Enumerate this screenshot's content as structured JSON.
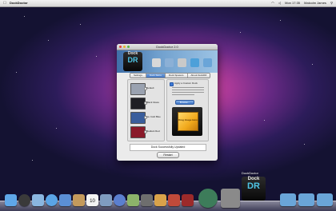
{
  "menubar": {
    "app": "DockDoctor",
    "clock": "Mon 17:35",
    "user": "Malcolm James"
  },
  "window": {
    "title": "DockDoctor 2.0",
    "logo_top": "Dock",
    "logo_main": "DR",
    "tabs": [
      {
        "label": "Settings",
        "active": false
      },
      {
        "label": "Dock Skins",
        "active": true
      },
      {
        "label": "Dock Spacers",
        "active": false
      },
      {
        "label": "About DockDR",
        "active": false
      }
    ],
    "themes": [
      {
        "label": "Default",
        "color": "#9aa2b0"
      },
      {
        "label": "Black Glass",
        "color": "#1f1f24"
      },
      {
        "label": "Ice Cold Blue",
        "color": "#3a5e9c"
      },
      {
        "label": "Radiant Red",
        "color": "#8a1a2a"
      }
    ],
    "custom_check_label": "Apply a Custom Dock",
    "browse_label": "Browse...",
    "preview_box_text": "Drag Image Here",
    "status": "Dock Successfully Updated",
    "restart_label": "Restart"
  },
  "dock": {
    "label": "DockDoctor",
    "logo_top": "Dock",
    "logo_main": "DR",
    "calendar_day": "10",
    "icons": [
      {
        "name": "finder-icon",
        "color": "#5fa7e8"
      },
      {
        "name": "dashboard-icon",
        "color": "#3a3a3a"
      },
      {
        "name": "mail-icon",
        "color": "#8ab6e0"
      },
      {
        "name": "safari-icon",
        "color": "#5aa4e6"
      },
      {
        "name": "ichat-icon",
        "color": "#5b8fd6"
      },
      {
        "name": "address-book-icon",
        "color": "#c49a5c"
      },
      {
        "name": "calendar-icon",
        "color": "#f4f4f4"
      },
      {
        "name": "preview-icon",
        "color": "#7f9cc0"
      },
      {
        "name": "itunes-icon",
        "color": "#5b7fcf"
      },
      {
        "name": "iphoto-icon",
        "color": "#8cb36a"
      },
      {
        "name": "imovie-icon",
        "color": "#6e6e6e"
      },
      {
        "name": "garageband-icon",
        "color": "#d9a24a"
      },
      {
        "name": "iwork-icon",
        "color": "#c04a3a"
      },
      {
        "name": "photo-booth-icon",
        "color": "#9c2a2a"
      },
      {
        "name": "time-machine-icon",
        "color": "#3d7c5a"
      },
      {
        "name": "system-preferences-icon",
        "color": "#8a8a8a"
      }
    ],
    "folders": [
      {
        "name": "applications-folder-icon"
      },
      {
        "name": "documents-folder-icon"
      },
      {
        "name": "downloads-folder-icon"
      }
    ]
  }
}
